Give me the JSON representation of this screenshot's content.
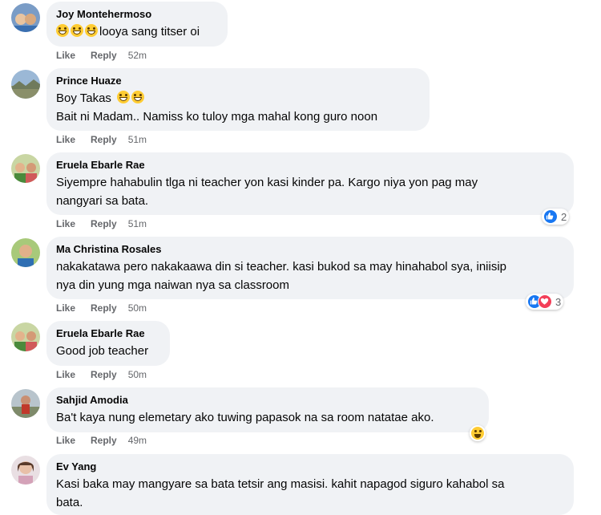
{
  "actions": {
    "like_label": "Like",
    "reply_label": "Reply"
  },
  "comments": [
    {
      "author": "Joy Montehermoso",
      "text": "looya sang titser oi",
      "leading_emoji": "grinning-face",
      "time": "52m"
    },
    {
      "author": "Prince Huaze",
      "text_line1": "Boy Takas",
      "text_line2": "Bait ni Madam.. Namiss ko tuloy mga mahal kong guro noon",
      "trailing_emoji": "grinning-face",
      "time": "51m"
    },
    {
      "author": "Eruela Ebarle Rae",
      "text_line1": "Siyempre hahabulin tlga ni teacher yon kasi kinder pa. Kargo niya yon pag may",
      "text_line2": "nangyari sa bata.",
      "time": "51m",
      "reaction_count": "2",
      "reaction_types": [
        "like"
      ]
    },
    {
      "author": "Ma Christina Rosales",
      "text_line1": "nakakatawa pero nakakaawa din si teacher. kasi bukod sa may hinahabol sya, iniisip",
      "text_line2": "nya din yung mga naiwan nya sa classroom",
      "time": "50m",
      "reaction_count": "3",
      "reaction_types": [
        "like",
        "love"
      ]
    },
    {
      "author": "Eruela Ebarle Rae",
      "text": "Good job teacher",
      "time": "50m"
    },
    {
      "author": "Sahjid Amodia",
      "text": "Ba't kaya nung elemetary ako tuwing papasok na sa room natatae ako.",
      "time": "49m",
      "reaction_types": [
        "haha"
      ]
    },
    {
      "author": "Ev Yang",
      "text_line1": "Kasi baka may mangyare sa bata tetsir ang masisi. kahit napagod siguro kahabol sa",
      "text_line2": "bata."
    }
  ],
  "colors": {
    "bubble": "#f0f2f5",
    "meta_text": "#65676b",
    "like_blue": "#1877f2",
    "love_red": "#f33e58"
  }
}
